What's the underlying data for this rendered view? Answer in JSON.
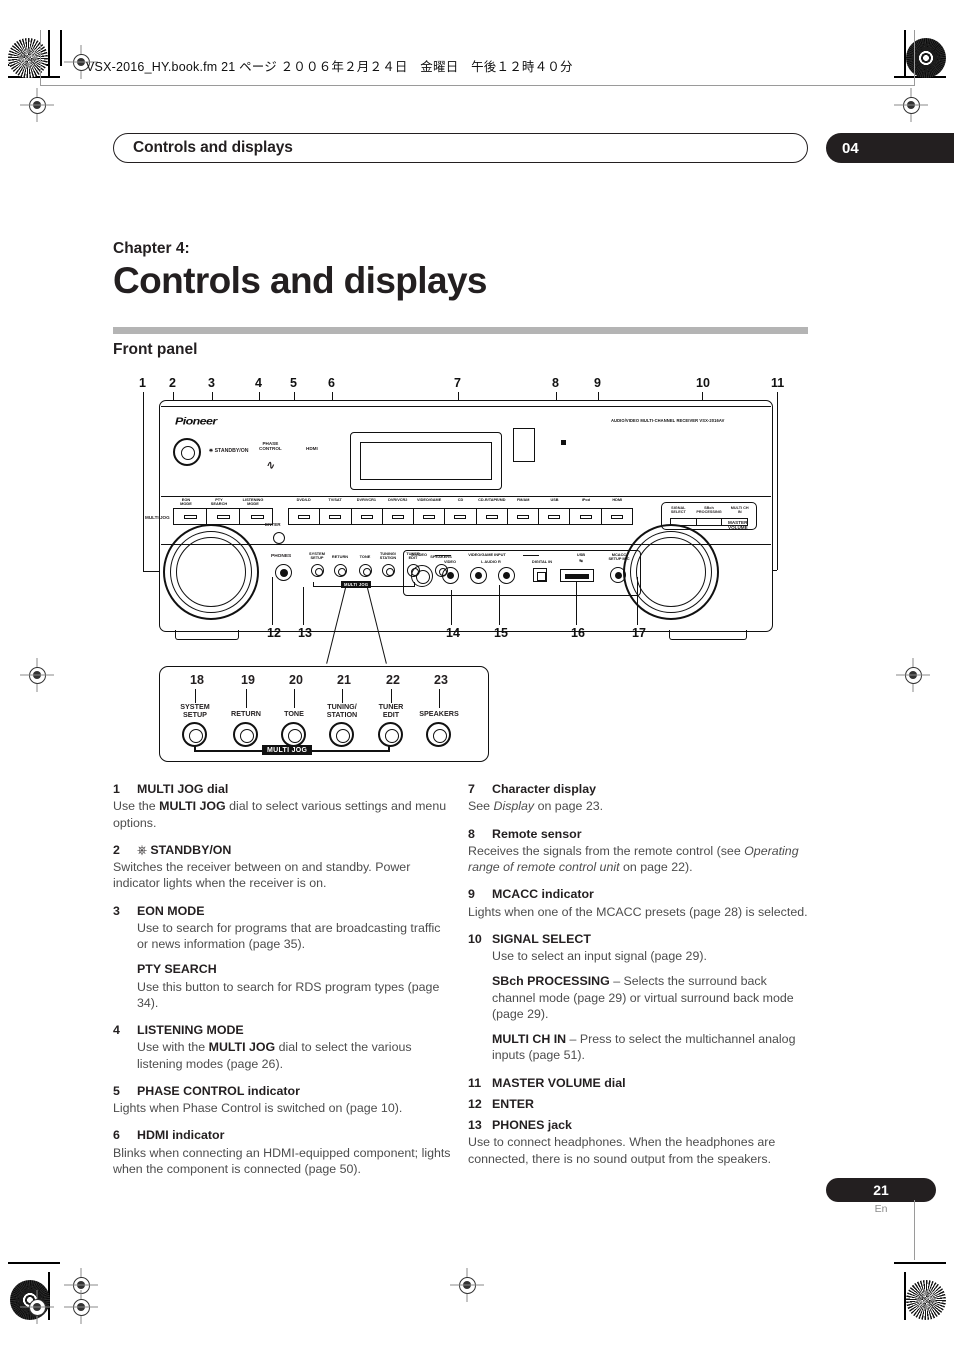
{
  "print_header": {
    "filename_line": "VSX-2016_HY.book.fm 21 ページ ２００６年２月２４日　金曜日　午後１２時４０分"
  },
  "running_head": {
    "title": "Controls and displays",
    "chapter_number": "04"
  },
  "chapter": {
    "label": "Chapter 4:",
    "title": "Controls and displays"
  },
  "section": {
    "title": "Front panel"
  },
  "figure": {
    "callouts_top": [
      "1",
      "2",
      "3",
      "4",
      "5",
      "6",
      "7",
      "8",
      "9",
      "10",
      "11"
    ],
    "callouts_bottom": [
      "12",
      "13",
      "14",
      "15",
      "16",
      "17"
    ],
    "brand": "Pioneer",
    "model_text": "AUDIO/VIDEO MULTI-CHANNEL RECEIVER VSX-2016AV",
    "standby_label": "STANDBY/ON",
    "phase_control_label": "PHASE CONTROL",
    "hdmi_indicator_label": "HDMI",
    "multi_jog_label": "MULTI JOG",
    "enter_label": "ENTER",
    "phones_label": "PHONES",
    "master_volume_label": "MASTER VOLUME",
    "left_buttons": [
      "EON MODE",
      "PTY SEARCH",
      "LISTENING MODE"
    ],
    "input_buttons": [
      "DVD/LD",
      "TV/SAT",
      "DVR/VCR1",
      "DVR/VCR2",
      "VIDEO/GAME",
      "CD",
      "CD-R/TAPE/MD",
      "FM/AM",
      "USB",
      "iPod",
      "HDMI"
    ],
    "signal_buttons": [
      "SIGNAL SELECT",
      "SBch PROCESSING",
      "MULTI CH IN"
    ],
    "front_buttons": [
      "SYSTEM SETUP",
      "RETURN",
      "TONE",
      "TUNING/STATION",
      "TUNER EDIT",
      "SPEAKERS"
    ],
    "multi_jog_tag": "MULTI JOG",
    "io_labels": {
      "s_video": "S-VIDEO",
      "group": "VIDEO/GAME INPUT",
      "video": "VIDEO",
      "audio": "L  AUDIO  R",
      "digital_in": "DIGITAL IN",
      "usb": "USB",
      "mcacc_mic": "MCACC SETUP MIC"
    },
    "detail_box": {
      "items": [
        {
          "num": "18",
          "label": "SYSTEM SETUP"
        },
        {
          "num": "19",
          "label": "RETURN"
        },
        {
          "num": "20",
          "label": "TONE"
        },
        {
          "num": "21",
          "label": "TUNING/STATION"
        },
        {
          "num": "22",
          "label": "TUNER EDIT"
        },
        {
          "num": "23",
          "label": "SPEAKERS"
        }
      ],
      "tag": "MULTI JOG"
    }
  },
  "left_column": {
    "item1_num": "1",
    "item1_head": "MULTI JOG dial",
    "item1_body_a": "Use the ",
    "item1_body_b": "MULTI JOG",
    "item1_body_c": " dial to select various settings and menu options.",
    "item2_num": "2",
    "item2_head": "STANDBY/ON",
    "item2_body": "Switches the receiver between on and standby. Power indicator lights when the receiver is on.",
    "item3_num": "3",
    "item3_head": "EON MODE",
    "item3_body": "Use to search for programs that are broadcasting traffic or news information (page 35).",
    "item3_sub": "PTY SEARCH",
    "item3_sub_body": "Use this button to search for RDS program types (page 34).",
    "item4_num": "4",
    "item4_head": "LISTENING MODE",
    "item4_body_a": "Use with the ",
    "item4_body_b": "MULTI JOG",
    "item4_body_c": " dial to select the various listening modes (page 26).",
    "item5_num": "5",
    "item5_head": "PHASE CONTROL indicator",
    "item5_body": "Lights when Phase Control is switched on (page 10).",
    "item6_num": "6",
    "item6_head": "HDMI indicator",
    "item6_body": "Blinks when connecting an HDMI-equipped component; lights when the component is connected (page 50)."
  },
  "right_column": {
    "item7_num": "7",
    "item7_head": "Character display",
    "item7_body_a": "See ",
    "item7_body_b": "Display",
    "item7_body_c": " on page 23.",
    "item8_num": "8",
    "item8_head": "Remote sensor",
    "item8_body_a": "Receives the signals from the remote control (see ",
    "item8_body_b": "Operating range of remote control unit",
    "item8_body_c": " on page 22).",
    "item9_num": "9",
    "item9_head": "MCACC indicator",
    "item9_body": "Lights when one of the MCACC presets (page 28) is selected.",
    "item10_num": "10",
    "item10_head": "SIGNAL SELECT",
    "item10_body": "Use to select an input signal (page 29).",
    "item10_sub1": "SBch PROCESSING",
    "item10_sub1_body": " – Selects the surround back channel mode (page 29) or virtual surround back mode (page 29).",
    "item10_sub2": "MULTI CH IN",
    "item10_sub2_body": " – Press to select the multichannel analog inputs (page 51).",
    "item11_num": "11",
    "item11_head": "MASTER VOLUME dial",
    "item12_num": "12",
    "item12_head": "ENTER",
    "item13_num": "13",
    "item13_head": "PHONES jack",
    "item13_body": "Use to connect headphones. When the headphones are connected, there is no sound output from the speakers."
  },
  "footer": {
    "page_number": "21",
    "language": "En"
  }
}
